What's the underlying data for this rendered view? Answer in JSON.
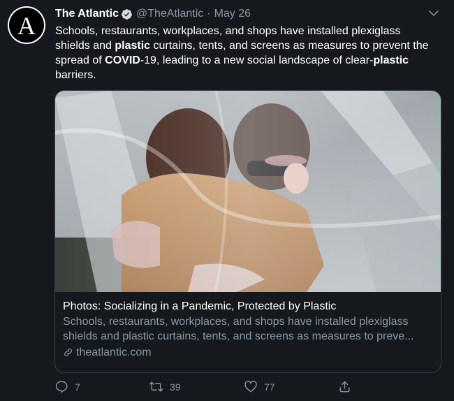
{
  "tweet": {
    "display_name": "The Atlantic",
    "handle": "@TheAtlantic",
    "separator": "·",
    "date": "May 26",
    "text": {
      "p1": "Schools, restaurants, workplaces, and shops have installed plexiglass shields and ",
      "b1": "plastic",
      "p2": " curtains, tents, and screens as measures to prevent the spread of ",
      "b2": "COVID",
      "p3": "-19, leading to a new social landscape of clear-",
      "b3": "plastic",
      "p4": " barriers."
    }
  },
  "avatar": {
    "letter": "A"
  },
  "card": {
    "title": "Photos: Socializing in a Pandemic, Protected by Plastic",
    "description_line1": "Schools, restaurants, workplaces, and shops have installed plexiglass",
    "description_line2": "shields and plastic curtains, tents, and screens as measures to preve...",
    "domain": "theatlantic.com"
  },
  "actions": {
    "reply_count": "7",
    "retweet_count": "39",
    "like_count": "77"
  },
  "colors": {
    "background": "#15181c",
    "text": "#ffffff",
    "secondary": "#8899a6",
    "border": "#38444d"
  },
  "icons": [
    "verified-badge-icon",
    "chevron-down-icon",
    "link-icon",
    "reply-icon",
    "retweet-icon",
    "like-icon",
    "share-icon"
  ]
}
